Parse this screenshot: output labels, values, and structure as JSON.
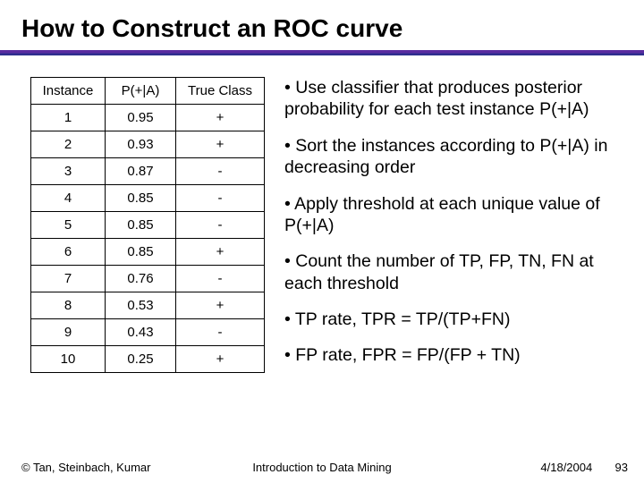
{
  "title": "How to Construct an ROC curve",
  "table": {
    "headers": [
      "Instance",
      "P(+|A)",
      "True Class"
    ],
    "rows": [
      [
        "1",
        "0.95",
        "+"
      ],
      [
        "2",
        "0.93",
        "+"
      ],
      [
        "3",
        "0.87",
        "-"
      ],
      [
        "4",
        "0.85",
        "-"
      ],
      [
        "5",
        "0.85",
        "-"
      ],
      [
        "6",
        "0.85",
        "+"
      ],
      [
        "7",
        "0.76",
        "-"
      ],
      [
        "8",
        "0.53",
        "+"
      ],
      [
        "9",
        "0.43",
        "-"
      ],
      [
        "10",
        "0.25",
        "+"
      ]
    ]
  },
  "bullets": [
    "• Use classifier that produces posterior probability for each test instance P(+|A)",
    "• Sort the instances according to P(+|A) in decreasing order",
    "• Apply threshold at each unique value of P(+|A)",
    "• Count the number of TP, FP, TN, FN at each threshold",
    "• TP rate, TPR = TP/(TP+FN)",
    "• FP rate, FPR = FP/(FP + TN)"
  ],
  "footer": {
    "left": "© Tan, Steinbach, Kumar",
    "mid": "Introduction to Data Mining",
    "date": "4/18/2004",
    "page": "93"
  },
  "chart_data": {
    "type": "table",
    "title": "How to Construct an ROC curve",
    "columns": [
      "Instance",
      "P(+|A)",
      "True Class"
    ],
    "rows": [
      {
        "Instance": 1,
        "P(+|A)": 0.95,
        "True Class": "+"
      },
      {
        "Instance": 2,
        "P(+|A)": 0.93,
        "True Class": "+"
      },
      {
        "Instance": 3,
        "P(+|A)": 0.87,
        "True Class": "-"
      },
      {
        "Instance": 4,
        "P(+|A)": 0.85,
        "True Class": "-"
      },
      {
        "Instance": 5,
        "P(+|A)": 0.85,
        "True Class": "-"
      },
      {
        "Instance": 6,
        "P(+|A)": 0.85,
        "True Class": "+"
      },
      {
        "Instance": 7,
        "P(+|A)": 0.76,
        "True Class": "-"
      },
      {
        "Instance": 8,
        "P(+|A)": 0.53,
        "True Class": "+"
      },
      {
        "Instance": 9,
        "P(+|A)": 0.43,
        "True Class": "-"
      },
      {
        "Instance": 10,
        "P(+|A)": 0.25,
        "True Class": "+"
      }
    ]
  }
}
